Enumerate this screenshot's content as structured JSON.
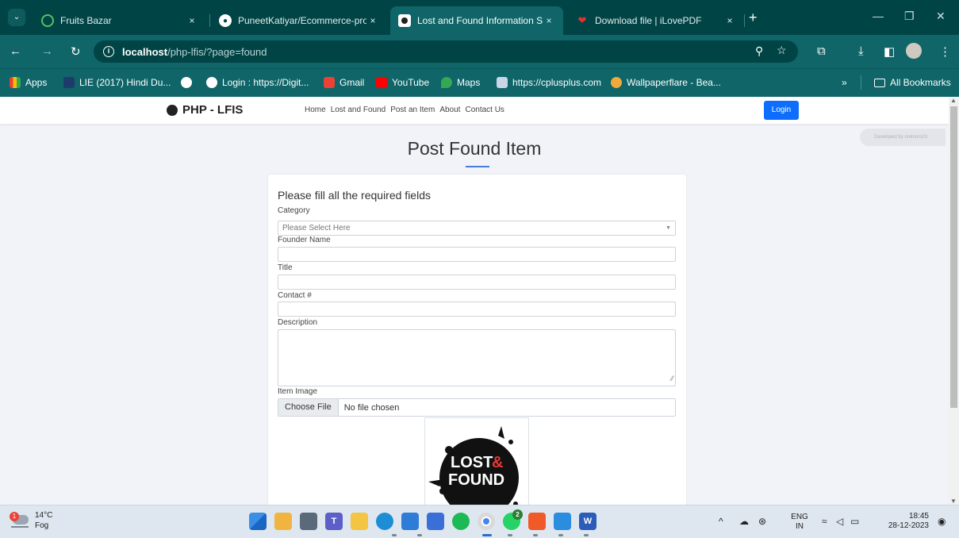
{
  "browser": {
    "tabs": [
      {
        "title": "Fruits Bazar",
        "active": false
      },
      {
        "title": "PuneetKatiyar/Ecommerce-proj",
        "active": false
      },
      {
        "title": "Lost and Found Information Sy",
        "active": true
      },
      {
        "title": "Download file | iLovePDF",
        "active": false
      }
    ],
    "close_glyph": "×",
    "new_tab_glyph": "+",
    "url_host": "localhost",
    "url_path": "/php-lfis/?page=found",
    "bookmarks": [
      "Apps",
      "LIE (2017) Hindi Du...",
      "Login : https://Digit...",
      "Gmail",
      "YouTube",
      "Maps",
      "https://cplusplus.com",
      "Wallpaperflare - Bea..."
    ],
    "all_bookmarks": "All Bookmarks",
    "overflow": "»"
  },
  "site": {
    "brand": "PHP - LFIS",
    "nav": [
      "Home",
      "Lost and Found",
      "Post an Item",
      "About",
      "Contact Us"
    ],
    "login": "Login",
    "dev_badge": "Developed by oretnom23",
    "page_title": "Post Found Item",
    "form": {
      "legend": "Please fill all the required fields",
      "category_label": "Category",
      "category_placeholder": "Please Select Here",
      "founder_label": "Founder Name",
      "title_label": "Title",
      "contact_label": "Contact #",
      "description_label": "Description",
      "image_label": "Item Image",
      "choose_file": "Choose File",
      "no_file": "No file chosen",
      "preview_line1": "LOST",
      "preview_amp": "&",
      "preview_line2": "FOUND"
    }
  },
  "taskbar": {
    "weather_temp": "14°C",
    "weather_desc": "Fog",
    "weather_badge": "1",
    "whatsapp_badge": "2",
    "lang1": "ENG",
    "lang2": "IN",
    "time": "18:45",
    "date": "28-12-2023"
  },
  "colors": {
    "chrome_dark": "#014446",
    "chrome": "#0f6568",
    "login_button": "#0d6efd",
    "page_bg": "#f1f3f8"
  }
}
